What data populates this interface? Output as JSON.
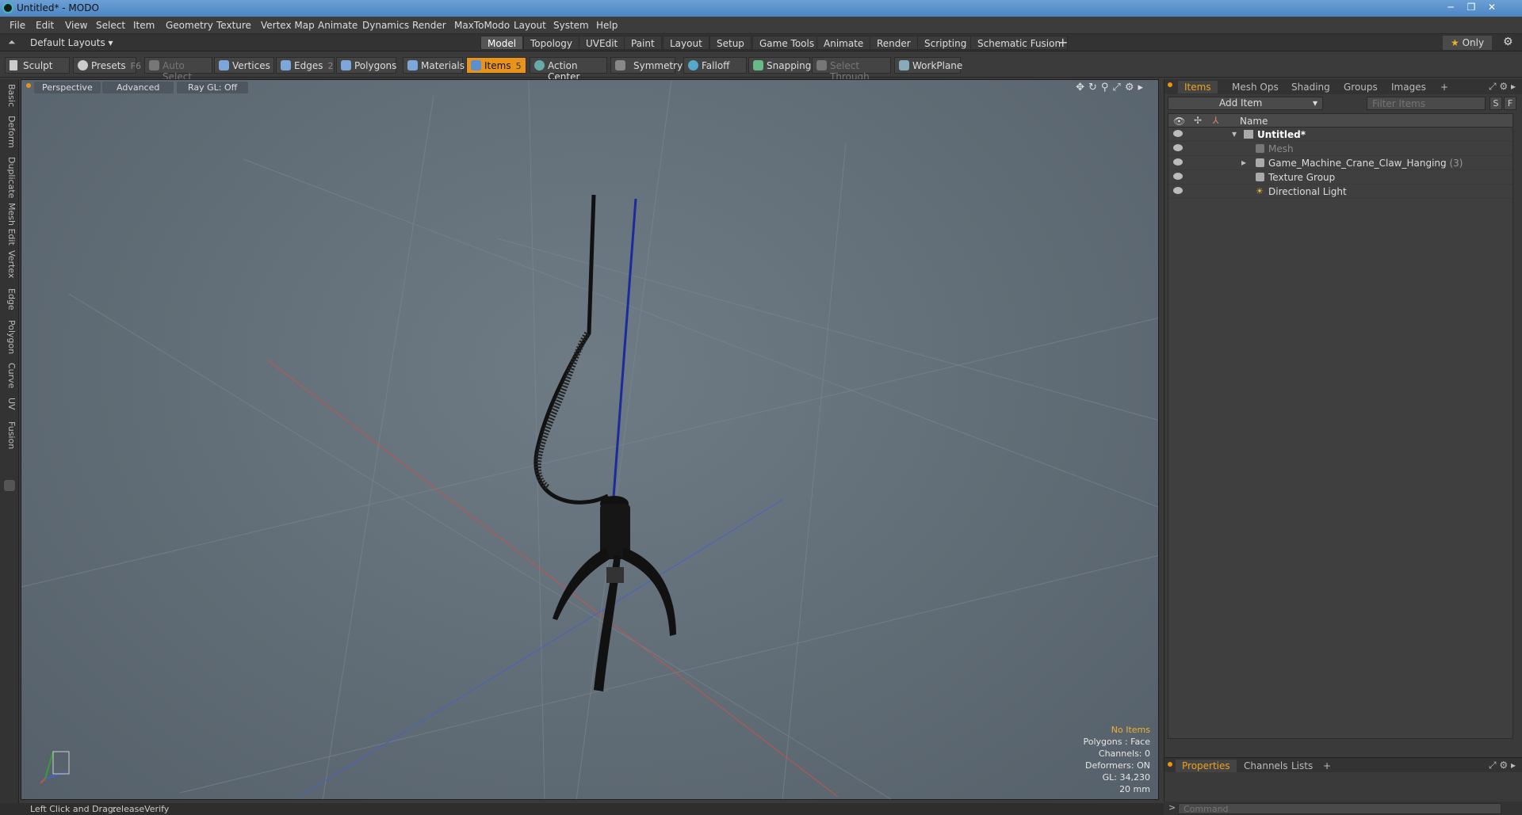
{
  "window": {
    "title": "Untitled* - MODO"
  },
  "menu": [
    "File",
    "Edit",
    "View",
    "Select",
    "Item",
    "Geometry",
    "Texture",
    "Vertex Map",
    "Animate",
    "Dynamics",
    "Render",
    "MaxToModo",
    "Layout",
    "System",
    "Help"
  ],
  "layout": {
    "dropdown": "Default Layouts",
    "tabs": [
      "Model",
      "Topology",
      "UVEdit",
      "Paint",
      "Layout",
      "Setup",
      "Game Tools",
      "Animate",
      "Render",
      "Scripting",
      "Schematic Fusion"
    ],
    "active_tab": "Model",
    "only_label": "Only"
  },
  "toolbar": {
    "sculpt": "Sculpt",
    "presets": "Presets",
    "presets_key": "F6",
    "auto_select": "Auto Select",
    "vertices": "Vertices",
    "vertices_key": "1",
    "edges": "Edges",
    "edges_key": "2",
    "polygons": "Polygons",
    "materials": "Materials",
    "items": "Items",
    "items_key": "5",
    "action_center": "Action Center",
    "symmetry": "Symmetry",
    "falloff": "Falloff",
    "snapping": "Snapping",
    "select_through": "Select Through",
    "workplane": "WorkPlane"
  },
  "left_tabs": [
    "Basic",
    "Deform",
    "Duplicate",
    "Mesh Edit",
    "Vertex",
    "Edge",
    "Polygon",
    "Curve",
    "UV",
    "Fusion"
  ],
  "viewport": {
    "view": "Perspective",
    "shading": "Advanced",
    "raygl": "Ray GL: Off",
    "info": {
      "items": "No Items",
      "polygons": "Polygons : Face",
      "channels": "Channels: 0",
      "deformers": "Deformers: ON",
      "gl": "GL: 34,230",
      "scale": "20 mm"
    }
  },
  "status": {
    "hint_label": "Left Click and Drag:",
    "hint_value": "releaseVerify"
  },
  "item_panel": {
    "tabs": [
      "Items",
      "Mesh Ops",
      "Shading",
      "Groups",
      "Images"
    ],
    "active_tab": "Items",
    "add_item": "Add Item",
    "filter_placeholder": "Filter Items",
    "s_btn": "S",
    "f_btn": "F",
    "col_name": "Name",
    "rows": [
      {
        "label": "Untitled*",
        "count": ""
      },
      {
        "label": "Mesh",
        "count": ""
      },
      {
        "label": "Game_Machine_Crane_Claw_Hanging",
        "count": "(3)"
      },
      {
        "label": "Texture Group",
        "count": ""
      },
      {
        "label": "Directional Light",
        "count": ""
      }
    ]
  },
  "properties": {
    "tabs": [
      "Properties",
      "Channels",
      "Lists"
    ],
    "active_tab": "Properties"
  },
  "command": {
    "placeholder": "Command"
  },
  "colors": {
    "accent": "#e8941a",
    "warning": "#f0b030",
    "axis_x": "#d04030",
    "axis_z": "#3050d0"
  }
}
